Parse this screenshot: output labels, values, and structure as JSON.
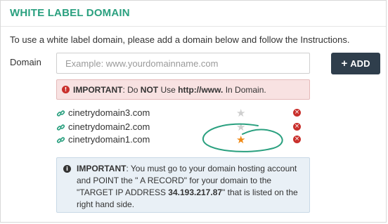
{
  "header": {
    "title": "WHITE LABEL DOMAIN"
  },
  "intro": "To use a white label domain, please add a domain below and follow the Instructions.",
  "form": {
    "label": "Domain",
    "placeholder": "Example: www.yourdomainname.com",
    "add_label": "ADD",
    "add_icon": "plus-icon"
  },
  "warning": {
    "icon": "exclamation-circle-icon",
    "strong": "IMPORTANT",
    "text1": ": Do ",
    "not": "NOT",
    "text2": " Use ",
    "www": "http://www.",
    "text3": " In Domain."
  },
  "domains": [
    {
      "name": "cinetrydomain3.com",
      "default": false
    },
    {
      "name": "cinetrydomain2.com",
      "default": false
    },
    {
      "name": "cinetrydomain1.com",
      "default": true
    }
  ],
  "info": {
    "icon": "info-circle-icon",
    "strong": "IMPORTANT",
    "text1": ": You must go to your domain hosting account and POINT the \" A RECORD\" for your domain to the \"TARGET IP ADDRESS ",
    "ip": "34.193.217.87",
    "text2": "\" that is listed on the right hand side."
  },
  "colors": {
    "accent": "#2aa07f",
    "button": "#2f3e4c",
    "danger": "#c9302c",
    "star_active": "#f08a16",
    "star_inactive": "#cfcfcf",
    "annotation": "#2aa07f"
  }
}
